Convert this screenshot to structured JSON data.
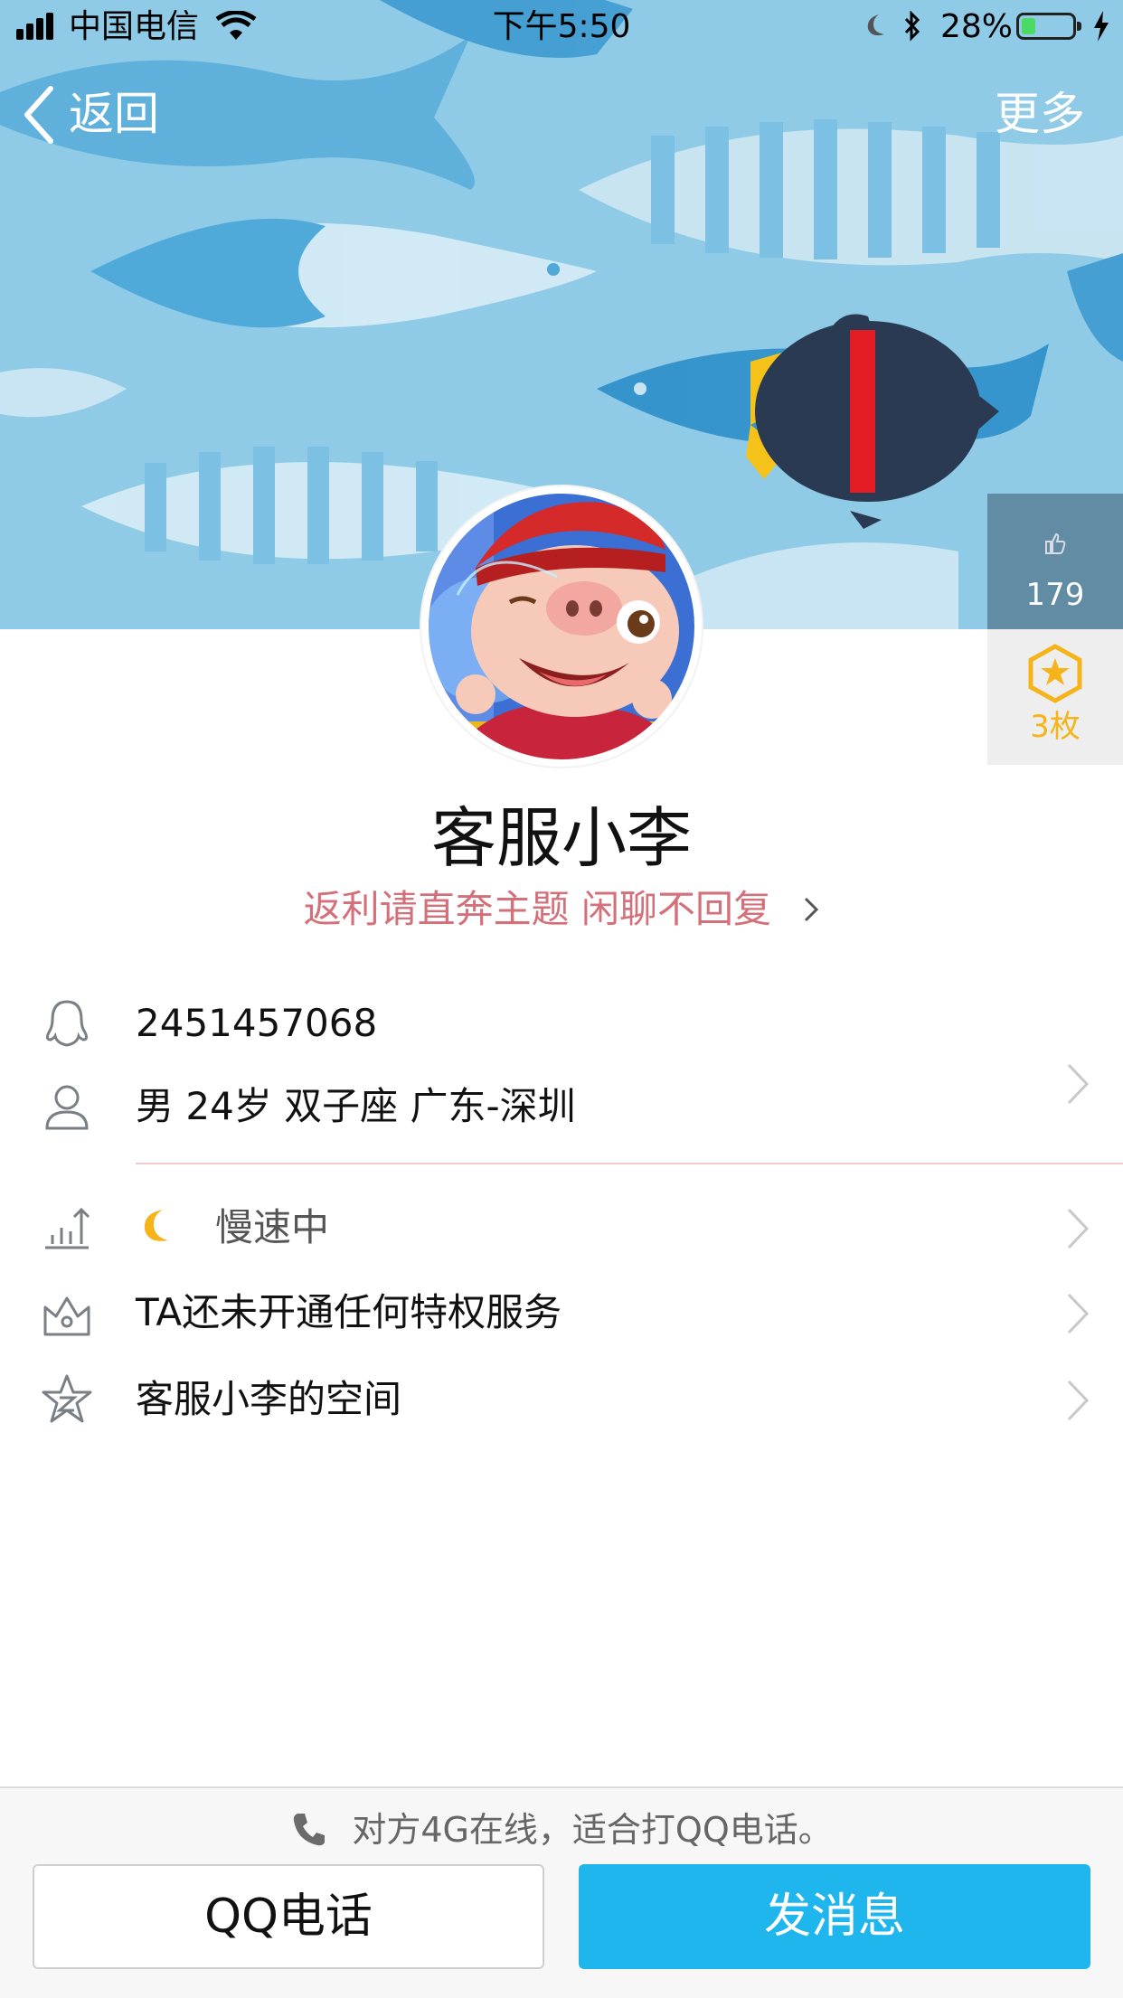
{
  "status_bar": {
    "carrier": "中国电信",
    "time": "下午5:50",
    "battery_percent": "28%",
    "battery_level": 0.28
  },
  "nav": {
    "back_label": "返回",
    "more_label": "更多"
  },
  "side_panel": {
    "likes_count": "179",
    "medals_label": "3枚"
  },
  "profile": {
    "name": "客服小李",
    "signature": "返利请直奔主题 闲聊不回复"
  },
  "info": {
    "qq_number": "2451457068",
    "details": "男 24岁 双子座 广东-深圳",
    "level_status": "慢速中",
    "privilege": "TA还未开通任何特权服务",
    "space": "客服小李的空间"
  },
  "bottom": {
    "hint": "对方4G在线，适合打QQ电话。",
    "call_button": "QQ电话",
    "message_button": "发消息"
  },
  "colors": {
    "accent_blue": "#1eb6ed",
    "signature_pink": "#d4707a",
    "medal_gold": "#f5b41a",
    "battery_green": "#4cd964"
  }
}
